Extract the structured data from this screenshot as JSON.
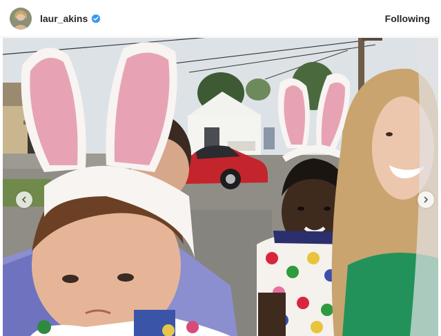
{
  "post": {
    "username": "laur_akins",
    "verified": true,
    "follow_label": "Following"
  },
  "carousel": {
    "prev_icon": "chevron-left-icon",
    "next_icon": "chevron-right-icon"
  },
  "colors": {
    "verified_blue": "#3897f0",
    "car_red": "#c4242c"
  }
}
